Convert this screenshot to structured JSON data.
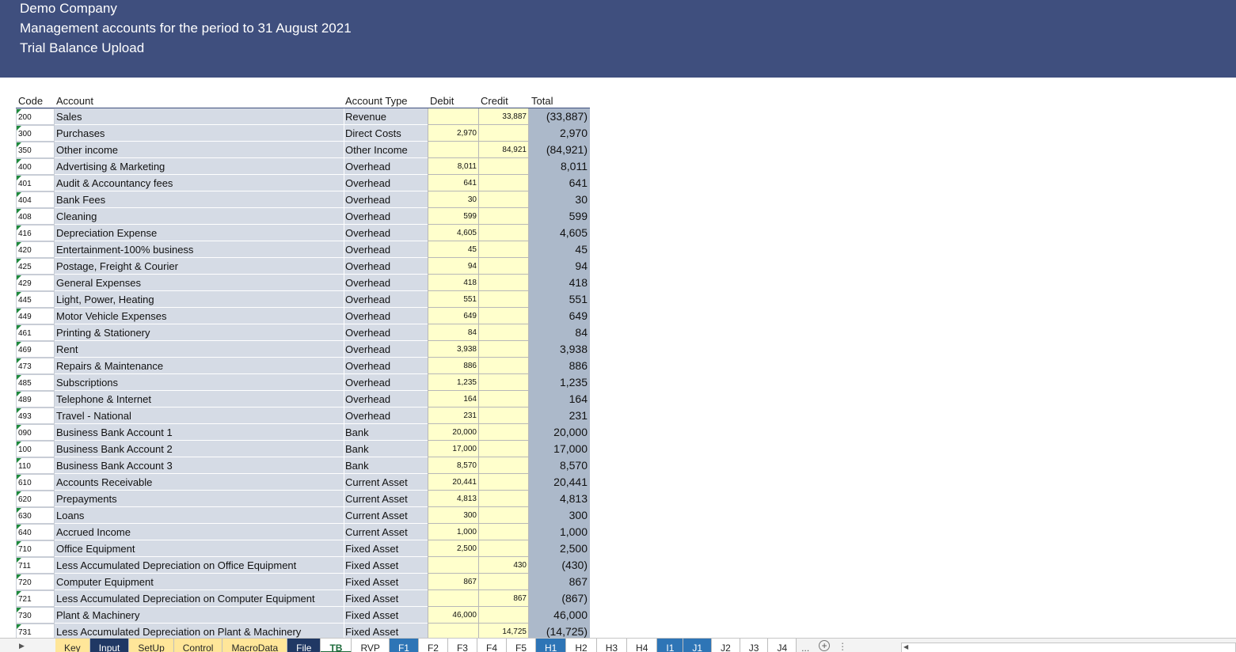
{
  "banner": {
    "company": "Demo Company",
    "report": "Management accounts for the period to 31 August 2021",
    "sheet_title": "Trial Balance Upload"
  },
  "table": {
    "headers": {
      "code": "Code",
      "account": "Account",
      "type": "Account Type",
      "debit": "Debit",
      "credit": "Credit",
      "total": "Total"
    },
    "rows": [
      {
        "code": "200",
        "account": "Sales",
        "type": "Revenue",
        "debit": "",
        "credit": "33,887",
        "total": "(33,887)"
      },
      {
        "code": "300",
        "account": "Purchases",
        "type": "Direct Costs",
        "debit": "2,970",
        "credit": "",
        "total": "2,970"
      },
      {
        "code": "350",
        "account": "Other income",
        "type": "Other Income",
        "debit": "",
        "credit": "84,921",
        "total": "(84,921)"
      },
      {
        "code": "400",
        "account": "Advertising & Marketing",
        "type": "Overhead",
        "debit": "8,011",
        "credit": "",
        "total": "8,011"
      },
      {
        "code": "401",
        "account": "Audit & Accountancy fees",
        "type": "Overhead",
        "debit": "641",
        "credit": "",
        "total": "641"
      },
      {
        "code": "404",
        "account": "Bank Fees",
        "type": "Overhead",
        "debit": "30",
        "credit": "",
        "total": "30"
      },
      {
        "code": "408",
        "account": "Cleaning",
        "type": "Overhead",
        "debit": "599",
        "credit": "",
        "total": "599"
      },
      {
        "code": "416",
        "account": "Depreciation Expense",
        "type": "Overhead",
        "debit": "4,605",
        "credit": "",
        "total": "4,605"
      },
      {
        "code": "420",
        "account": "Entertainment-100% business",
        "type": "Overhead",
        "debit": "45",
        "credit": "",
        "total": "45"
      },
      {
        "code": "425",
        "account": "Postage, Freight & Courier",
        "type": "Overhead",
        "debit": "94",
        "credit": "",
        "total": "94"
      },
      {
        "code": "429",
        "account": "General Expenses",
        "type": "Overhead",
        "debit": "418",
        "credit": "",
        "total": "418"
      },
      {
        "code": "445",
        "account": "Light, Power, Heating",
        "type": "Overhead",
        "debit": "551",
        "credit": "",
        "total": "551"
      },
      {
        "code": "449",
        "account": "Motor Vehicle Expenses",
        "type": "Overhead",
        "debit": "649",
        "credit": "",
        "total": "649"
      },
      {
        "code": "461",
        "account": "Printing & Stationery",
        "type": "Overhead",
        "debit": "84",
        "credit": "",
        "total": "84"
      },
      {
        "code": "469",
        "account": "Rent",
        "type": "Overhead",
        "debit": "3,938",
        "credit": "",
        "total": "3,938"
      },
      {
        "code": "473",
        "account": "Repairs & Maintenance",
        "type": "Overhead",
        "debit": "886",
        "credit": "",
        "total": "886"
      },
      {
        "code": "485",
        "account": "Subscriptions",
        "type": "Overhead",
        "debit": "1,235",
        "credit": "",
        "total": "1,235"
      },
      {
        "code": "489",
        "account": "Telephone & Internet",
        "type": "Overhead",
        "debit": "164",
        "credit": "",
        "total": "164"
      },
      {
        "code": "493",
        "account": "Travel - National",
        "type": "Overhead",
        "debit": "231",
        "credit": "",
        "total": "231"
      },
      {
        "code": "090",
        "account": "Business Bank Account 1",
        "type": "Bank",
        "debit": "20,000",
        "credit": "",
        "total": "20,000"
      },
      {
        "code": "100",
        "account": "Business Bank Account 2",
        "type": "Bank",
        "debit": "17,000",
        "credit": "",
        "total": "17,000"
      },
      {
        "code": "110",
        "account": "Business Bank Account 3",
        "type": "Bank",
        "debit": "8,570",
        "credit": "",
        "total": "8,570"
      },
      {
        "code": "610",
        "account": "Accounts Receivable",
        "type": "Current Asset",
        "debit": "20,441",
        "credit": "",
        "total": "20,441"
      },
      {
        "code": "620",
        "account": "Prepayments",
        "type": "Current Asset",
        "debit": "4,813",
        "credit": "",
        "total": "4,813"
      },
      {
        "code": "630",
        "account": "Loans",
        "type": "Current Asset",
        "debit": "300",
        "credit": "",
        "total": "300"
      },
      {
        "code": "640",
        "account": "Accrued Income",
        "type": "Current Asset",
        "debit": "1,000",
        "credit": "",
        "total": "1,000"
      },
      {
        "code": "710",
        "account": "Office Equipment",
        "type": "Fixed Asset",
        "debit": "2,500",
        "credit": "",
        "total": "2,500"
      },
      {
        "code": "711",
        "account": "Less Accumulated Depreciation on Office Equipment",
        "type": "Fixed Asset",
        "debit": "",
        "credit": "430",
        "total": "(430)"
      },
      {
        "code": "720",
        "account": "Computer Equipment",
        "type": "Fixed Asset",
        "debit": "867",
        "credit": "",
        "total": "867"
      },
      {
        "code": "721",
        "account": "Less Accumulated Depreciation on Computer Equipment",
        "type": "Fixed Asset",
        "debit": "",
        "credit": "867",
        "total": "(867)"
      },
      {
        "code": "730",
        "account": "Plant & Machinery",
        "type": "Fixed Asset",
        "debit": "46,000",
        "credit": "",
        "total": "46,000"
      },
      {
        "code": "731",
        "account": "Less Accumulated Depreciation on Plant & Machinery",
        "type": "Fixed Asset",
        "debit": "",
        "credit": "14,725",
        "total": "(14,725)"
      }
    ]
  },
  "sheet_tabs": [
    {
      "label": "Key",
      "style": "yellow"
    },
    {
      "label": "Input",
      "style": "navy"
    },
    {
      "label": "SetUp",
      "style": "yellow"
    },
    {
      "label": "Control",
      "style": "yellow"
    },
    {
      "label": "MacroData",
      "style": "yellow"
    },
    {
      "label": "File",
      "style": "navy"
    },
    {
      "label": "TB",
      "style": "active"
    },
    {
      "label": "RVP",
      "style": "white"
    },
    {
      "label": "F1",
      "style": "blue"
    },
    {
      "label": "F2",
      "style": "white"
    },
    {
      "label": "F3",
      "style": "white"
    },
    {
      "label": "F4",
      "style": "white"
    },
    {
      "label": "F5",
      "style": "white"
    },
    {
      "label": "H1",
      "style": "blue"
    },
    {
      "label": "H2",
      "style": "white"
    },
    {
      "label": "H3",
      "style": "white"
    },
    {
      "label": "H4",
      "style": "white"
    },
    {
      "label": "I1",
      "style": "blue"
    },
    {
      "label": "J1",
      "style": "blue"
    },
    {
      "label": "J2",
      "style": "white"
    },
    {
      "label": "J3",
      "style": "white"
    },
    {
      "label": "J4",
      "style": "white"
    }
  ],
  "tabbar": {
    "more": "...",
    "add": "+",
    "options": "⋮"
  }
}
